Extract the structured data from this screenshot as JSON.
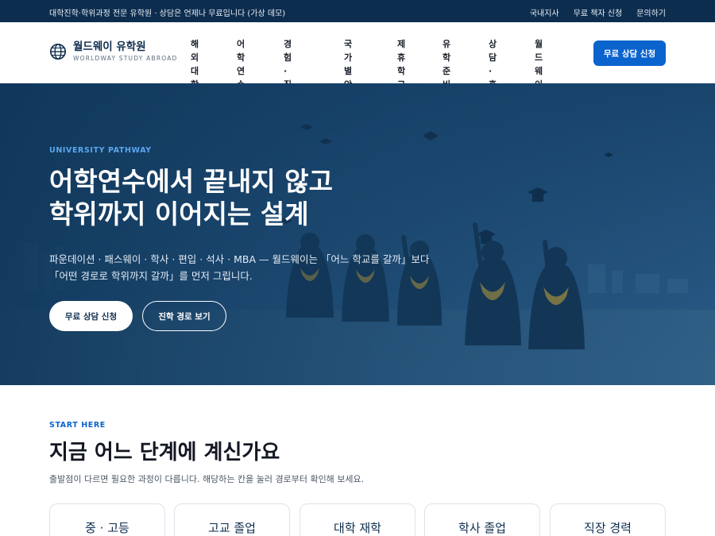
{
  "topbar": {
    "notice": "대학진학·학위과정 전문 유학원 · 상담은 언제나 무료입니다 (가상 데모)",
    "links": [
      "국내지사",
      "무료 책자 신청",
      "문의하기"
    ]
  },
  "brand": {
    "name": "월드웨이 유학원",
    "subtitle": "WORLDWAY STUDY ABROAD",
    "icon": "globe-icon"
  },
  "nav": {
    "items": [
      "해외\n대학",
      "어학연수",
      "경험·\n직업과정",
      "국가별\n안내",
      "제휴\n학교",
      "유학\n준비",
      "상담·\n후기",
      "월드웨이\n소개"
    ],
    "cta": "무료 상담 신청"
  },
  "hero": {
    "eyebrow": "UNIVERSITY PATHWAY",
    "headline_line1": "어학연수에서 끝내지 않고",
    "headline_line2": "학위까지 이어지는 설계",
    "desc_line1": "파운데이션 · 패스웨이 · 학사 · 편입 · 석사 · MBA — 월드웨이는 「어느 학교를 갈까」보다",
    "desc_line2": "「어떤 경로로 학위까지 갈까」를 먼저 그립니다.",
    "primary_button": "무료 상담 신청",
    "secondary_button": "진학 경로 보기"
  },
  "start": {
    "eyebrow": "START HERE",
    "title": "지금 어느 단계에 계신가요",
    "lead": "출발점이 다르면 필요한 과정이 다릅니다. 해당하는 칸을 눌러 경로부터 확인해 보세요.",
    "cards": [
      "중 · 고등",
      "고교 졸업",
      "대학 재학",
      "학사 졸업",
      "직장 경력"
    ]
  },
  "colors": {
    "navy": "#0d2d4e",
    "accent": "#0b63ce",
    "hero_overlay": "#1d4a72",
    "eyebrow_blue": "#5aa7f0"
  }
}
